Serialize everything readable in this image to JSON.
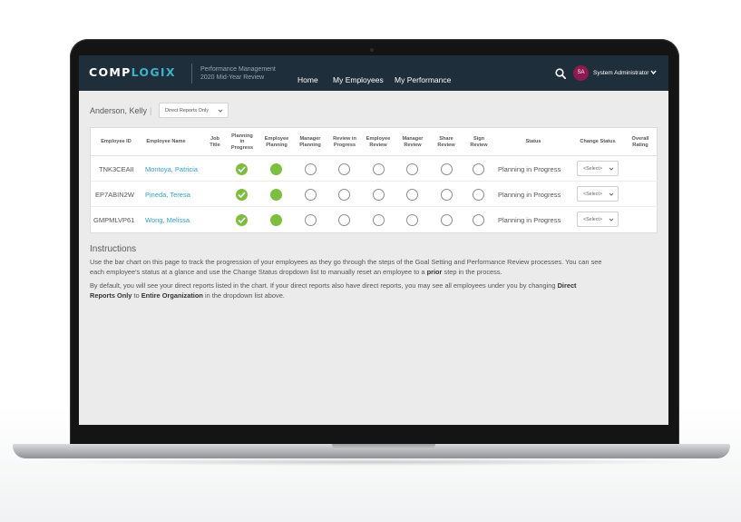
{
  "app": {
    "logo_main": "COMP",
    "logo_accent": "LOGIX",
    "subtitle_line1": "Performance Management",
    "subtitle_line2": "2020 Mid-Year Review"
  },
  "nav": {
    "items": [
      "Home",
      "My Employees",
      "My Performance"
    ]
  },
  "user": {
    "initials": "SA",
    "name": "System Administrator"
  },
  "filter": {
    "manager_name": "Anderson, Kelly",
    "separator": "|",
    "scope_value": "Direct Reports Only"
  },
  "table": {
    "headers": {
      "employee_id": "Employee ID",
      "employee_name": "Employee Name",
      "job_title_1": "Job",
      "job_title_2": "Title",
      "planning_in_progress_1": "Planning",
      "planning_in_progress_2": "in",
      "planning_in_progress_3": "Progress",
      "employee_planning_1": "Employee",
      "employee_planning_2": "Planning",
      "manager_planning_1": "Manager",
      "manager_planning_2": "Planning",
      "review_in_progress_1": "Review in",
      "review_in_progress_2": "Progress",
      "employee_review_1": "Employee",
      "employee_review_2": "Review",
      "manager_review_1": "Manager",
      "manager_review_2": "Review",
      "share_review_1": "Share",
      "share_review_2": "Review",
      "sign_review_1": "Sign",
      "sign_review_2": "Review",
      "status": "Status",
      "change_status": "Change Status",
      "overall_rating_1": "Overall",
      "overall_rating_2": "Rating"
    },
    "rows": [
      {
        "id": "TNK3CEAII",
        "name": "Montoya, Patricia",
        "job_title": "",
        "steps": [
          "checked",
          "filled",
          "empty",
          "empty",
          "empty",
          "empty",
          "empty",
          "empty"
        ],
        "status": "Planning in Progress",
        "change_status": "<Select>",
        "overall_rating": ""
      },
      {
        "id": "EP7ABIN2W",
        "name": "Pineda, Teresa",
        "job_title": "",
        "steps": [
          "checked",
          "filled",
          "empty",
          "empty",
          "empty",
          "empty",
          "empty",
          "empty"
        ],
        "status": "Planning in Progress",
        "change_status": "<Select>",
        "overall_rating": ""
      },
      {
        "id": "GMPMLVP61",
        "name": "Wong, Melissa",
        "job_title": "",
        "steps": [
          "checked",
          "filled",
          "empty",
          "empty",
          "empty",
          "empty",
          "empty",
          "empty"
        ],
        "status": "Planning in Progress",
        "change_status": "<Select>",
        "overall_rating": ""
      }
    ]
  },
  "instructions": {
    "title": "Instructions",
    "p1_line1": "Use the bar chart on this page to track the progression of your employees as they go through the steps of the Goal Setting and Performance Review processes. You can see",
    "p1_line2_a": "each employee's status at a glance and use the Change Status dropdown list to manually reset an employee to a",
    "p1_line2_bold": "prior",
    "p1_line2_b": "step in the process.",
    "p2_line1_a": "By default, you will see your direct reports listed in the chart. If your direct reports also have direct reports, you may see all employees under you by changing",
    "p2_line1_bold": "Direct",
    "p2_line2_bold1": "Reports Only",
    "p2_line2_a": "to",
    "p2_line2_bold2": "Entire Organization",
    "p2_line2_b": "in the dropdown list above."
  },
  "colors": {
    "topbar": "#1f2e3b",
    "accent": "#3ab3c9",
    "link": "#2aa3c2",
    "complete": "#7cbf3a",
    "avatar": "#8d1b4f"
  }
}
